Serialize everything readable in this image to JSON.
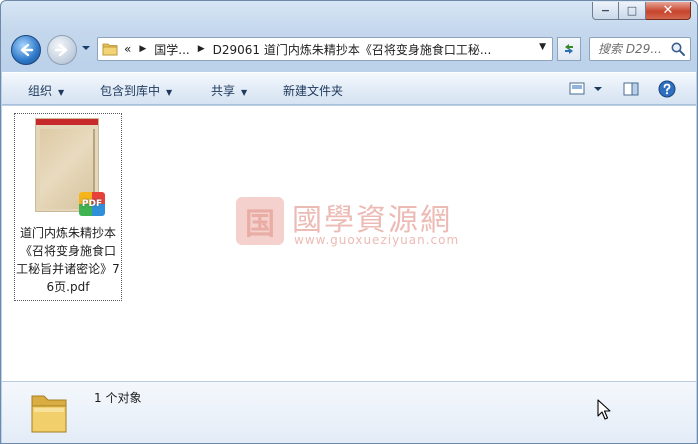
{
  "window": {
    "controls": {
      "minimize": "−",
      "maximize": "□",
      "close": "✕"
    }
  },
  "nav": {
    "breadcrumb": [
      {
        "label": "«"
      },
      {
        "label": "国学..."
      },
      {
        "label": "D29061 道门内炼朱精抄本《召将变身施食口工秘..."
      }
    ],
    "search_placeholder": "搜索 D29..."
  },
  "toolbar": {
    "organize": "组织",
    "include_library": "包含到库中",
    "share": "共享",
    "new_folder": "新建文件夹"
  },
  "files": [
    {
      "name": "道门内炼朱精抄本《召将变身施食口工秘旨并诸密论》76页.pdf",
      "badge": "PDF"
    }
  ],
  "watermark": {
    "seal": "国",
    "title": "國學資源網",
    "url": "www.guoxueziyuan.com"
  },
  "details": {
    "count": "1 个对象"
  },
  "colors": {
    "accent": "#1e395b",
    "close_button": "#c7442c",
    "watermark": "#eab4ad"
  }
}
